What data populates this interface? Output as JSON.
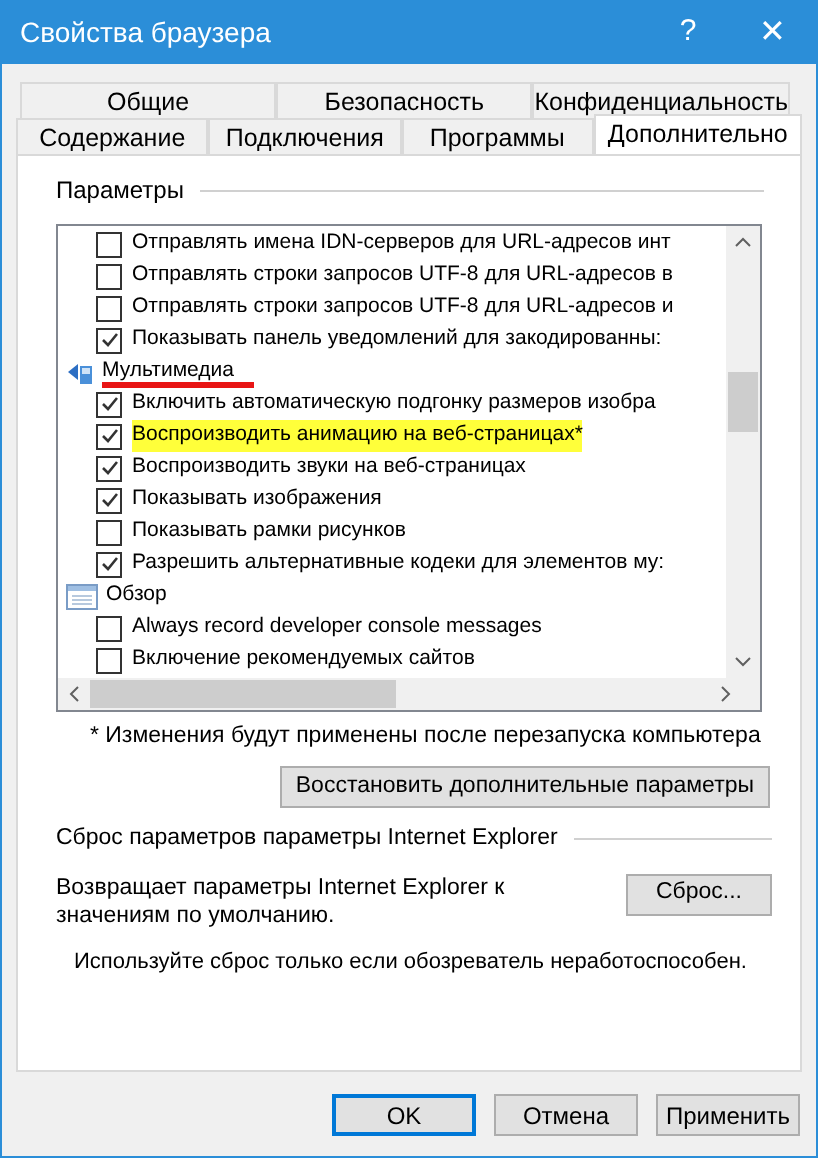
{
  "window": {
    "title": "Свойства браузера",
    "help": "?",
    "close": "✕"
  },
  "tab_rows": [
    [
      {
        "label": "Общие",
        "selected": false
      },
      {
        "label": "Безопасность",
        "selected": false
      },
      {
        "label": "Конфиденциальность",
        "selected": false
      }
    ],
    [
      {
        "label": "Содержание",
        "selected": false
      },
      {
        "label": "Подключения",
        "selected": false
      },
      {
        "label": "Программы",
        "selected": false
      },
      {
        "label": "Дополнительно",
        "selected": true
      }
    ]
  ],
  "settings": {
    "title": "Параметры",
    "items": [
      {
        "kind": "option",
        "label": "Отправлять имена IDN-серверов для URL-адресов инт",
        "checked": false,
        "highlighted": false
      },
      {
        "kind": "option",
        "label": "Отправлять строки запросов UTF-8 для URL-адресов в",
        "checked": false,
        "highlighted": false
      },
      {
        "kind": "option",
        "label": "Отправлять строки запросов UTF-8 для URL-адресов и",
        "checked": false,
        "highlighted": false
      },
      {
        "kind": "option",
        "label": "Показывать панель уведомлений для закодированны:",
        "checked": true,
        "highlighted": false
      },
      {
        "kind": "media_group",
        "label": "Мультимедиа",
        "underlined": true
      },
      {
        "kind": "option",
        "label": "Включить автоматическую подгонку размеров изобра",
        "checked": true,
        "highlighted": false
      },
      {
        "kind": "option",
        "label": "Воспроизводить анимацию на веб-страницах*",
        "checked": true,
        "highlighted": true
      },
      {
        "kind": "option",
        "label": "Воспроизводить звуки на веб-страницах",
        "checked": true,
        "highlighted": false
      },
      {
        "kind": "option",
        "label": "Показывать изображения",
        "checked": true,
        "highlighted": false
      },
      {
        "kind": "option",
        "label": "Показывать рамки рисунков",
        "checked": false,
        "highlighted": false
      },
      {
        "kind": "option",
        "label": "Разрешить альтернативные кодеки для элементов му:",
        "checked": true,
        "highlighted": false
      },
      {
        "kind": "browse_group",
        "label": "Обзор",
        "underlined": false
      },
      {
        "kind": "option",
        "label": "Always record developer console messages",
        "checked": false,
        "highlighted": false
      },
      {
        "kind": "option",
        "label": "Включение рекомендуемых сайтов",
        "checked": false,
        "highlighted": false
      }
    ],
    "note": "* Изменения будут применены после перезапуска компьютера",
    "restore_button": "Восстановить дополнительные параметры"
  },
  "reset": {
    "title": "Сброс параметров параметры Internet Explorer",
    "description": "Возвращает параметры Internet Explorer к значениям по умолчанию.",
    "button": "Сброс...",
    "warning": "Используйте сброс только если обозреватель неработоспособен."
  },
  "buttons": [
    {
      "label": "OK",
      "default": true
    },
    {
      "label": "Отмена",
      "default": false
    },
    {
      "label": "Применить",
      "default": false
    }
  ]
}
